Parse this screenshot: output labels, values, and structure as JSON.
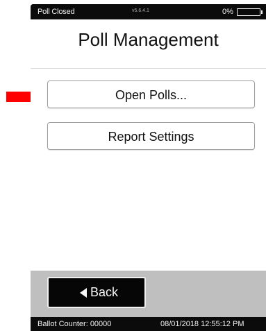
{
  "status_bar": {
    "poll_status": "Poll Closed",
    "version": "v5.6.4.1",
    "battery_percent": "0%",
    "battery_level": 0
  },
  "screen": {
    "title": "Poll Management",
    "buttons": [
      {
        "label": "Open Polls..."
      },
      {
        "label": "Report Settings"
      }
    ]
  },
  "footer": {
    "back_label": "Back"
  },
  "bottom_bar": {
    "ballot_counter": "Ballot Counter: 00000",
    "datetime": "08/01/2018 12:55:12 PM"
  },
  "annotation": {
    "arrow_color": "#ff0000",
    "arrow_icon": "red-arrow-right"
  }
}
